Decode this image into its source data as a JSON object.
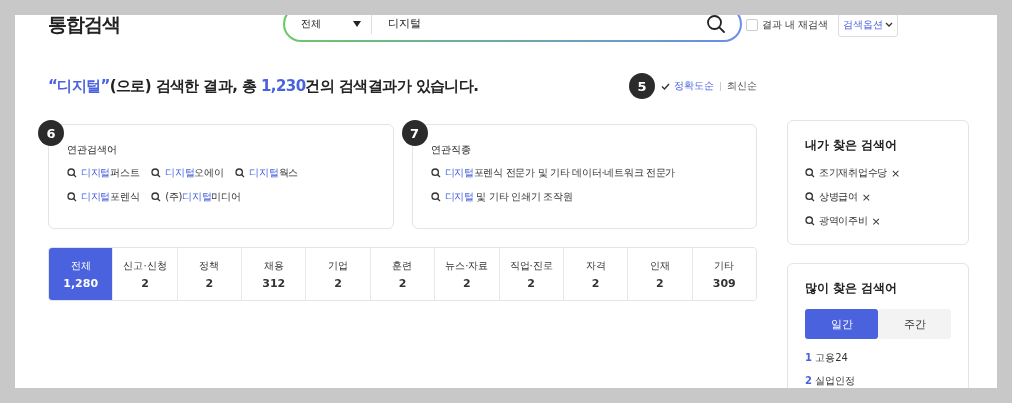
{
  "title": "통합검색",
  "search": {
    "scope": "전체",
    "value": "디지털",
    "refine": {
      "label": "결과 내 재검색",
      "checked": false
    },
    "options_button": "검색옵션"
  },
  "summary": {
    "quote_open": "“",
    "keyword": "디지털",
    "quote_close": "”",
    "text_a": "(으로) 검색한 결과, 총 ",
    "count": "1,230",
    "text_b": "건의 검색결과가 있습니다."
  },
  "sort": {
    "badge": "5",
    "options": [
      {
        "label": "정확도순",
        "selected": true
      },
      {
        "label": "최신순",
        "selected": false
      }
    ]
  },
  "related": [
    {
      "badge": "6",
      "title": "연관검색어",
      "rows": [
        [
          {
            "hit": "디지털",
            "post": "퍼스트"
          },
          {
            "hit": "디지털",
            "post": "오에이"
          },
          {
            "hit": "디지털",
            "post": "웍스"
          }
        ],
        [
          {
            "hit": "디지털",
            "post": "포렌식"
          },
          {
            "pre": "(주)",
            "hit": "디지털",
            "post": "미디어"
          }
        ]
      ]
    },
    {
      "badge": "7",
      "title": "연관직종",
      "rows": [
        [
          {
            "hit": "디지털",
            "post": "포렌식 전문가 및 기타 데이터·네트워크 전문가"
          }
        ],
        [
          {
            "hit": "디지털",
            "post": " 및 기타 인쇄기 조작원"
          }
        ]
      ]
    }
  ],
  "categories": [
    {
      "label": "전체",
      "count": "1,280",
      "selected": true
    },
    {
      "label": "신고·신청",
      "count": "2",
      "selected": false
    },
    {
      "label": "정책",
      "count": "2",
      "selected": false
    },
    {
      "label": "채용",
      "count": "312",
      "selected": false
    },
    {
      "label": "기업",
      "count": "2",
      "selected": false
    },
    {
      "label": "훈련",
      "count": "2",
      "selected": false
    },
    {
      "label": "뉴스·자료",
      "count": "2",
      "selected": false
    },
    {
      "label": "직업·진로",
      "count": "2",
      "selected": false
    },
    {
      "label": "자격",
      "count": "2",
      "selected": false
    },
    {
      "label": "인재",
      "count": "2",
      "selected": false
    },
    {
      "label": "기타",
      "count": "309",
      "selected": false
    }
  ],
  "my_searches": {
    "title": "내가 찾은 검색어",
    "items": [
      "조기재취업수당",
      "상병급여",
      "광역이주비"
    ],
    "remove": "×"
  },
  "popular": {
    "title": "많이 찾은 검색어",
    "tabs": [
      {
        "label": "일간",
        "selected": true
      },
      {
        "label": "주간",
        "selected": false
      }
    ],
    "items": [
      {
        "rank": "1",
        "label": "고용24"
      },
      {
        "rank": "2",
        "label": "실업인정"
      }
    ]
  }
}
